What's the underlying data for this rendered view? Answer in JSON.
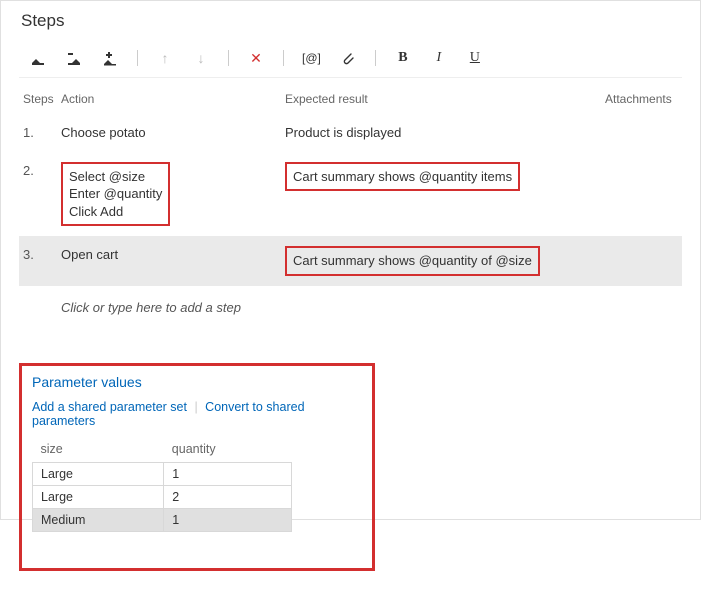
{
  "title": "Steps",
  "toolbar": {
    "at_label": "[@]"
  },
  "columns": {
    "steps": "Steps",
    "action": "Action",
    "expected": "Expected result",
    "attachments": "Attachments"
  },
  "steps": [
    {
      "num": "1.",
      "action": "Choose potato",
      "expected": "Product is displayed",
      "action_highlight": false,
      "expected_highlight": false,
      "selected": false
    },
    {
      "num": "2.",
      "action": "Select @size\nEnter @quantity\nClick Add",
      "expected": "Cart summary shows @quantity items",
      "action_highlight": true,
      "expected_highlight": true,
      "selected": false
    },
    {
      "num": "3.",
      "action": "Open cart",
      "expected": "Cart summary shows @quantity of @size",
      "action_highlight": false,
      "expected_highlight": true,
      "selected": true
    }
  ],
  "placeholder": "Click or type here to add a step",
  "params": {
    "title": "Parameter values",
    "link_add": "Add a shared parameter set",
    "link_convert": "Convert to shared parameters",
    "columns": {
      "size": "size",
      "quantity": "quantity"
    },
    "rows": [
      {
        "size": "Large",
        "quantity": "1",
        "selected": false
      },
      {
        "size": "Large",
        "quantity": "2",
        "selected": false
      },
      {
        "size": "Medium",
        "quantity": "1",
        "selected": true
      }
    ]
  }
}
